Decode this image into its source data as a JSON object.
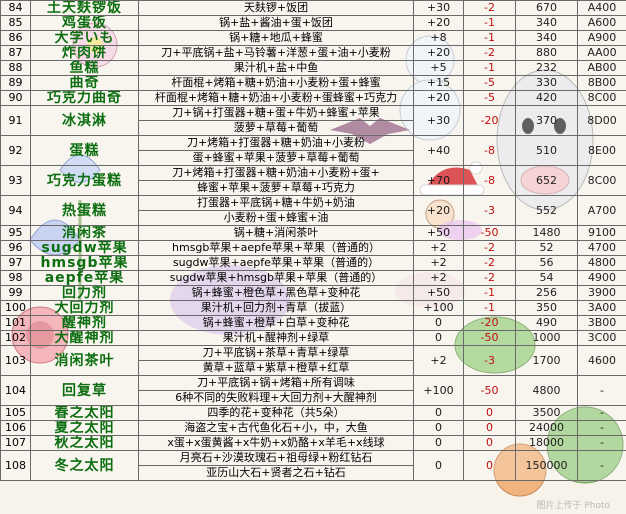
{
  "rows": [
    {
      "num": "84",
      "name": "土天麸锣饭",
      "ing": [
        "天麸锣+饭团"
      ],
      "v1": "+30",
      "v2": "-2",
      "v3": "670",
      "code": "A400"
    },
    {
      "num": "85",
      "name": "鸡蛋饭",
      "ing": [
        "锅+盐+酱油+蛋+饭团"
      ],
      "v1": "+20",
      "v2": "-1",
      "v3": "340",
      "code": "A600"
    },
    {
      "num": "86",
      "name": "大学いも",
      "ing": [
        "锅+糖+地瓜+蜂蜜"
      ],
      "v1": "+8",
      "v2": "-1",
      "v3": "340",
      "code": "A900"
    },
    {
      "num": "87",
      "name": "炸肉饼",
      "ing": [
        "刀+平底锅+盐+马铃薯+洋葱+蛋+油+小麦粉"
      ],
      "v1": "+20",
      "v2": "-2",
      "v3": "880",
      "code": "AA00"
    },
    {
      "num": "88",
      "name": "鱼糕",
      "ing": [
        "果汁机+盐+中鱼"
      ],
      "v1": "+5",
      "v2": "-1",
      "v3": "232",
      "code": "AB00"
    },
    {
      "num": "89",
      "name": "曲奇",
      "ing": [
        "杆面棍+烤箱+糖+奶油+小麦粉+蛋+蜂蜜"
      ],
      "v1": "+15",
      "v2": "-5",
      "v3": "330",
      "code": "8B00"
    },
    {
      "num": "90",
      "name": "巧克力曲奇",
      "ing": [
        "杆面棍+烤箱+糖+奶油+小麦粉+蛋蜂蜜+巧克力"
      ],
      "v1": "+20",
      "v2": "-5",
      "v3": "420",
      "code": "8C00"
    },
    {
      "num": "91",
      "name": "冰淇淋",
      "ing": [
        "刀+锅+打蛋器+糖+蛋+牛奶+蜂蜜+苹果",
        "菠萝+草莓+葡萄"
      ],
      "v1": "+30",
      "v2": "-20",
      "v3": "370",
      "code": "8D00"
    },
    {
      "num": "92",
      "name": "蛋糕",
      "ing": [
        "刀+烤箱+打蛋器+糖+奶油+小麦粉",
        "蛋+蜂蜜+苹果+菠萝+草莓+葡萄"
      ],
      "v1": "+40",
      "v2": "-8",
      "v3": "510",
      "code": "8E00"
    },
    {
      "num": "93",
      "name": "巧克力蛋糕",
      "ing": [
        "刀+烤箱+打蛋器+糖+奶油+小麦粉+蛋+",
        "蜂蜜+苹果+菠萝+草莓+巧克力"
      ],
      "v1": "+70",
      "v2": "-8",
      "v3": "652",
      "code": "8C00"
    },
    {
      "num": "94",
      "name": "热蛋糕",
      "ing": [
        "打蛋器+平底锅+糖+牛奶+奶油",
        "小麦粉+蛋+蜂蜜+油"
      ],
      "v1": "+20",
      "v2": "-3",
      "v3": "552",
      "code": "A700"
    },
    {
      "num": "95",
      "name": "消闲茶",
      "ing": [
        "锅+糖+消闲茶叶"
      ],
      "v1": "+50",
      "v2": "-50",
      "v3": "1480",
      "code": "9100"
    },
    {
      "num": "96",
      "name": "sugdw苹果",
      "ing": [
        "hmsgb苹果+aepfe苹果+苹果（普通的）"
      ],
      "v1": "+2",
      "v2": "-2",
      "v3": "52",
      "code": "4700"
    },
    {
      "num": "97",
      "name": "hmsgb苹果",
      "ing": [
        "sugdw苹果+aepfe苹果+苹果（普通的）"
      ],
      "v1": "+2",
      "v2": "-2",
      "v3": "56",
      "code": "4800"
    },
    {
      "num": "98",
      "name": "aepfe苹果",
      "ing": [
        "sugdw苹果+hmsgb苹果+苹果（普通的）"
      ],
      "v1": "+2",
      "v2": "-2",
      "v3": "54",
      "code": "4900"
    },
    {
      "num": "99",
      "name": "回力剂",
      "ing": [
        "锅+蜂蜜+橙色草+黑色草+变种花"
      ],
      "v1": "+50",
      "v2": "-1",
      "v3": "256",
      "code": "3900"
    },
    {
      "num": "100",
      "name": "大回力剂",
      "ing": [
        "果汁机+回力剂+青草（拔蓝）"
      ],
      "v1": "+100",
      "v2": "-1",
      "v3": "350",
      "code": "3A00"
    },
    {
      "num": "101",
      "name": "醒神剂",
      "ing": [
        "锅+蜂蜜+橙草+白草+变种花"
      ],
      "v1": "0",
      "v2": "-20",
      "v3": "490",
      "code": "3B00"
    },
    {
      "num": "102",
      "name": "大醒神剂",
      "ing": [
        "果汁机+醒神剂+绿草"
      ],
      "v1": "0",
      "v2": "-50",
      "v3": "1000",
      "code": "3C00"
    },
    {
      "num": "103",
      "name": "消闲茶叶",
      "ing": [
        "刀+平底锅+茶草+青草+绿草",
        "黄草+蓝草+紫草+橙草+红草"
      ],
      "v1": "+2",
      "v2": "-3",
      "v3": "1700",
      "code": "4600"
    },
    {
      "num": "104",
      "name": "回复草",
      "ing": [
        "刀+平底锅+锅+烤箱+所有调味",
        "6种不同的失败料理+大回力剂+大醒神剂"
      ],
      "v1": "+100",
      "v2": "-50",
      "v3": "4800",
      "code": "-"
    },
    {
      "num": "105",
      "name": "春之太阳",
      "ing": [
        "四季的花+变种花（共5朵）"
      ],
      "v1": "0",
      "v2": "0",
      "v3": "3500",
      "code": "-"
    },
    {
      "num": "106",
      "name": "夏之太阳",
      "ing": [
        "海盗之宝+古代鱼化石+小，中，大鱼"
      ],
      "v1": "0",
      "v2": "0",
      "v3": "24000",
      "code": "-"
    },
    {
      "num": "107",
      "name": "秋之太阳",
      "ing": [
        "x蛋+x蛋黄酱+x牛奶+x奶酪+x羊毛+x线球"
      ],
      "v1": "0",
      "v2": "0",
      "v3": "18000",
      "code": "-"
    },
    {
      "num": "108",
      "name": "冬之太阳",
      "ing": [
        "月亮石+沙漠玫瑰石+祖母绿+粉红钻石",
        "亚历山大石+贤者之石+钻石"
      ],
      "v1": "0",
      "v2": "0",
      "v3": "150000",
      "code": "-"
    }
  ],
  "colors": {
    "name": "#0c6e10",
    "negative": "#c01010",
    "grid": "#6a6a6a"
  },
  "decorations": [
    "snowman-icon",
    "santa-hat-icon",
    "angel-icon",
    "flower-icon",
    "tulip-icon",
    "rose-icon",
    "fruit-icon",
    "bat-icon",
    "cow-icon"
  ],
  "watermark": "图片上传于 Photo"
}
